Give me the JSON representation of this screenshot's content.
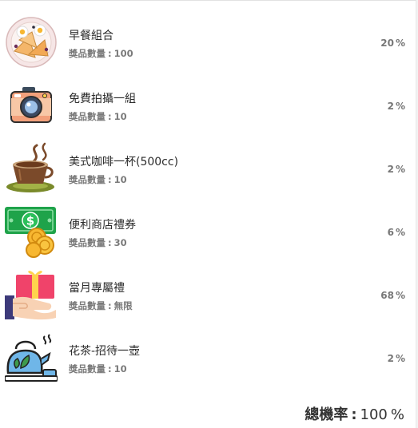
{
  "prizes": [
    {
      "name": "早餐組合",
      "quantity_label": "獎品數量",
      "quantity": "100",
      "probability": "20",
      "icon": "breakfast-plate-icon"
    },
    {
      "name": "免費拍攝一組",
      "quantity_label": "獎品數量",
      "quantity": "10",
      "probability": "2",
      "icon": "camera-icon"
    },
    {
      "name": "美式咖啡一杯(500cc)",
      "quantity_label": "獎品數量",
      "quantity": "10",
      "probability": "2",
      "icon": "coffee-cup-icon"
    },
    {
      "name": "便利商店禮券",
      "quantity_label": "獎品數量",
      "quantity": "30",
      "probability": "6",
      "icon": "cash-coins-icon"
    },
    {
      "name": "當月專屬禮",
      "quantity_label": "獎品數量",
      "quantity": "無限",
      "probability": "68",
      "icon": "gift-box-icon"
    },
    {
      "name": "花茶-招待一壺",
      "quantity_label": "獎品數量",
      "quantity": "10",
      "probability": "2",
      "icon": "teapot-icon"
    }
  ],
  "percent_sign": "%",
  "colon": ":",
  "total": {
    "label": "總機率",
    "value": "100"
  }
}
